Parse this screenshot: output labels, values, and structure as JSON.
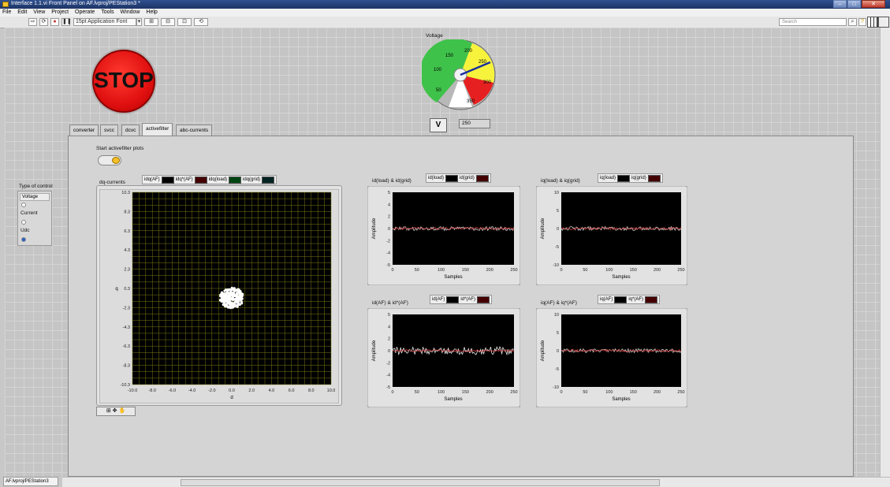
{
  "window": {
    "title": "Interface 1.1.vi Front Panel on AF.lvproj/PEStation3 *",
    "status_tab": "AF.lvproj/PEStation3"
  },
  "menu": [
    "File",
    "Edit",
    "View",
    "Project",
    "Operate",
    "Tools",
    "Window",
    "Help"
  ],
  "toolbar": {
    "font_select": "15pt Application Font",
    "search_placeholder": "Search"
  },
  "stop_button": {
    "label": "STOP"
  },
  "gauge": {
    "label": "Voltage",
    "value": 250,
    "ticks": [
      "50",
      "100",
      "150",
      "200",
      "250",
      "300",
      "350"
    ],
    "zones": [
      "green",
      "yellow",
      "red"
    ]
  },
  "v_button": {
    "label": "V"
  },
  "numeric_indicator": {
    "value": "250"
  },
  "tabs": [
    "converter",
    "svcc",
    "dcvc",
    "activefilter",
    "abc-currents"
  ],
  "active_tab": "activefilter",
  "toggle": {
    "label": "Start activefilter plots",
    "state": "on"
  },
  "type_of_control": {
    "label": "Type of control",
    "options": [
      "Voltage",
      "Current",
      "Udc"
    ],
    "selected": "Udc"
  },
  "xy_graph": {
    "title": "dq-currents",
    "legend": [
      "idq(AF)",
      "idq*(AF)",
      "idq(load)",
      "idq(grid)"
    ],
    "xlabel": "d",
    "ylabel": "q",
    "xticks": [
      "-10.0",
      "-8.0",
      "-6.0",
      "-4.0",
      "-2.0",
      "0.0",
      "2.0",
      "4.0",
      "6.0",
      "8.0",
      "10.0"
    ],
    "yticks": [
      "10.3",
      "8.3",
      "6.3",
      "4.3",
      "2.3",
      "0.3",
      "-2.3",
      "-4.3",
      "-6.3",
      "-8.3",
      "-10.3"
    ]
  },
  "graphs": [
    {
      "title": "id(load) & id(grid)",
      "legend": [
        "id(load)",
        "id(grid)"
      ],
      "ylabel": "Amplitude",
      "xlabel": "Samples",
      "yticks": [
        "5",
        "4",
        "2",
        "0",
        "-2",
        "-4",
        "-5"
      ],
      "xticks": [
        "0",
        "50",
        "100",
        "150",
        "200",
        "250"
      ]
    },
    {
      "title": "iq(load) & iq(grid)",
      "legend": [
        "iq(load)",
        "iq(grid)"
      ],
      "ylabel": "Amplitude",
      "xlabel": "Samples",
      "yticks": [
        "10",
        "5",
        "0",
        "-5",
        "-10"
      ],
      "xticks": [
        "0",
        "50",
        "100",
        "150",
        "200",
        "250"
      ]
    },
    {
      "title": "id(AF) & id*(AF)",
      "legend": [
        "id(AF)",
        "id*(AF)"
      ],
      "ylabel": "Amplitude",
      "xlabel": "Samples",
      "yticks": [
        "5",
        "4",
        "2",
        "0",
        "-2",
        "-4",
        "-5"
      ],
      "xticks": [
        "0",
        "50",
        "100",
        "150",
        "200",
        "250"
      ]
    },
    {
      "title": "iq(AF) & iq*(AF)",
      "legend": [
        "iq(AF)",
        "iq*(AF)"
      ],
      "ylabel": "Amplitude",
      "xlabel": "Samples",
      "yticks": [
        "10",
        "5",
        "0",
        "-5",
        "-10"
      ],
      "xticks": [
        "0",
        "50",
        "100",
        "150",
        "200",
        "250"
      ]
    }
  ]
}
